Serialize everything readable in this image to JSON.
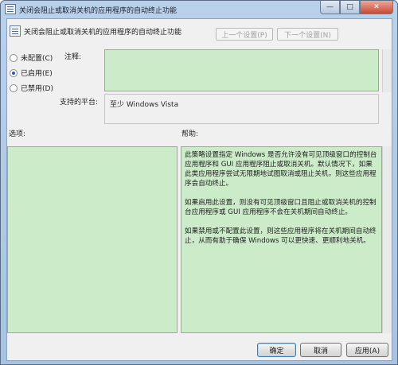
{
  "window": {
    "title": "关闭会阻止或取消关机的应用程序的自动终止功能",
    "minimize_label": "—",
    "maximize_label": "□",
    "close_label": "✕"
  },
  "header": {
    "title": "关闭会阻止或取消关机的应用程序的自动终止功能",
    "prev_setting": "上一个设置(P)",
    "next_setting": "下一个设置(N)"
  },
  "state_options": [
    {
      "label": "未配置(C)",
      "checked": false
    },
    {
      "label": "已启用(E)",
      "checked": true
    },
    {
      "label": "已禁用(D)",
      "checked": false
    }
  ],
  "comment_label": "注释:",
  "platform_label": "支持的平台:",
  "platform_value": "至少 Windows Vista",
  "options_label": "选项:",
  "help_label": "帮助:",
  "help_paragraphs": [
    "此策略设置指定 Windows 是否允许没有可见顶级窗口的控制台应用程序和 GUI 应用程序阻止或取消关机。默认情况下，如果此类应用程序尝试无限期地试图取消或阻止关机，则这些应用程序会自动终止。",
    "如果启用此设置，则没有可见顶级窗口且阻止或取消关机的控制台应用程序或 GUI 应用程序不会在关机期间自动终止。",
    "如果禁用或不配置此设置，则这些应用程序将在关机期间自动终止，从而有助于确保 Windows 可以更快速、更顺利地关机。"
  ],
  "buttons": {
    "ok": "确定",
    "cancel": "取消",
    "apply": "应用(A)"
  },
  "colors": {
    "panel_green": "#ccebc9",
    "dialog_bg": "#f0f0f0"
  }
}
